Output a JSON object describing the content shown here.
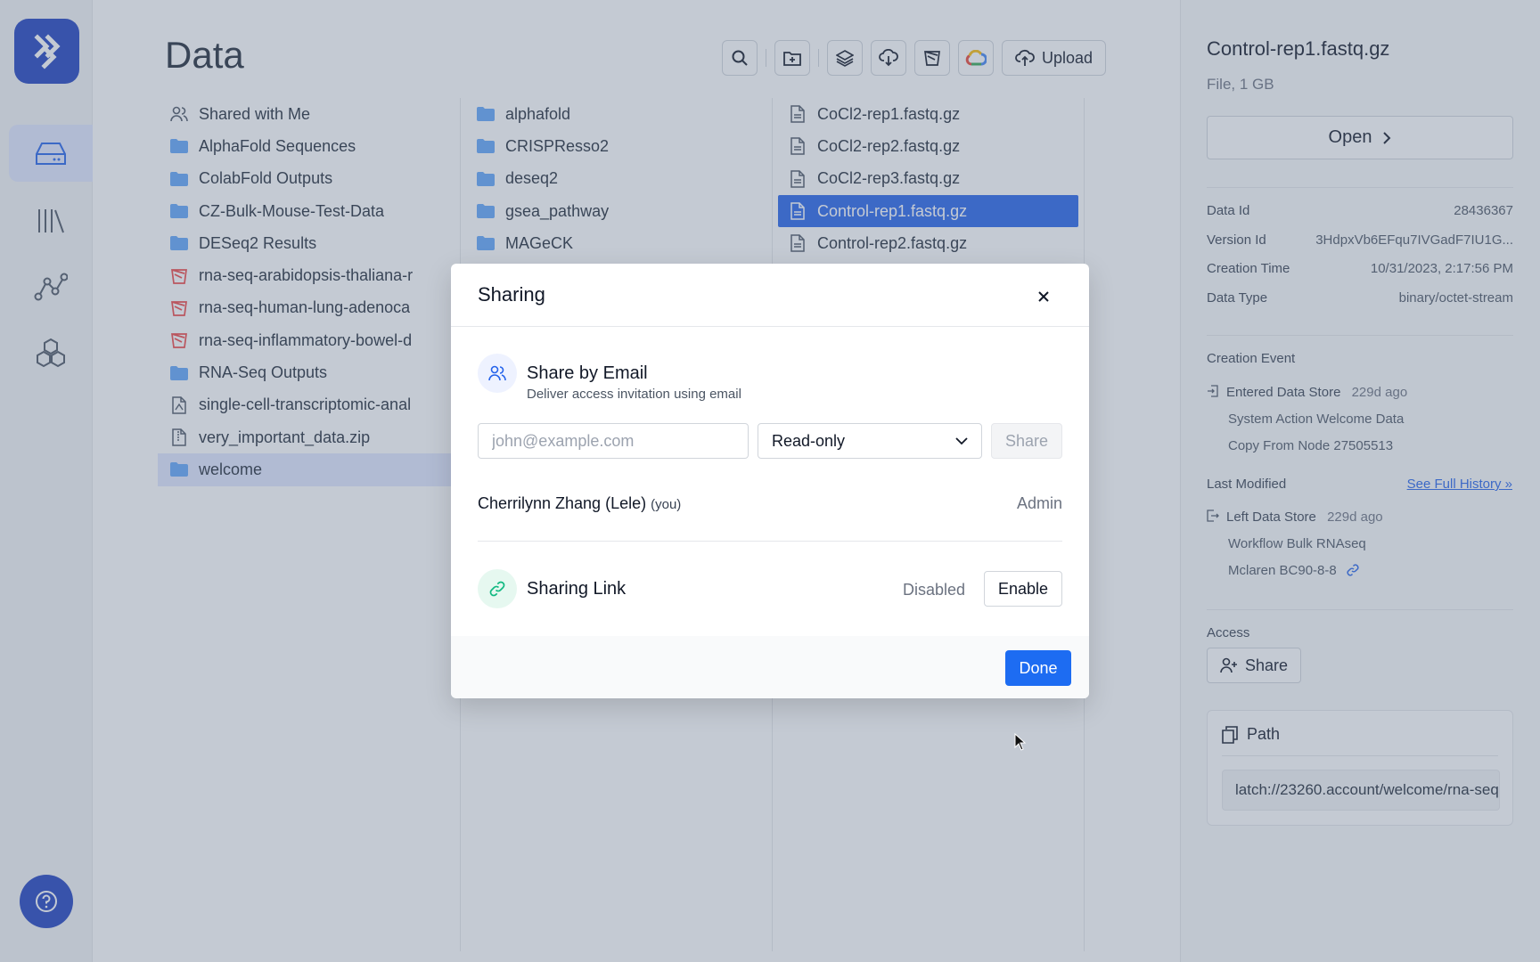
{
  "main": {
    "title": "Data",
    "toolbar": {
      "upload_label": "Upload",
      "icons": [
        "search-icon",
        "new-folder-icon",
        "layers-icon",
        "cloud-download-icon",
        "bucket-icon",
        "google-cloud-icon",
        "upload-cloud-icon"
      ]
    },
    "column1": [
      {
        "label": "Shared with Me",
        "icon": "users-icon"
      },
      {
        "label": "AlphaFold Sequences",
        "icon": "folder-icon"
      },
      {
        "label": "ColabFold Outputs",
        "icon": "folder-icon"
      },
      {
        "label": "CZ-Bulk-Mouse-Test-Data",
        "icon": "folder-icon"
      },
      {
        "label": "DESeq2 Results",
        "icon": "folder-icon"
      },
      {
        "label": "rna-seq-arabidopsis-thaliana-r",
        "icon": "bucket-icon"
      },
      {
        "label": "rna-seq-human-lung-adenoca",
        "icon": "bucket-icon"
      },
      {
        "label": "rna-seq-inflammatory-bowel-d",
        "icon": "bucket-icon"
      },
      {
        "label": "RNA-Seq Outputs",
        "icon": "folder-icon"
      },
      {
        "label": "single-cell-transcriptomic-anal",
        "icon": "file-icon"
      },
      {
        "label": "very_important_data.zip",
        "icon": "zip-file-icon"
      },
      {
        "label": "welcome",
        "icon": "folder-icon",
        "selected": true
      }
    ],
    "column2": [
      {
        "label": "alphafold",
        "icon": "folder-icon"
      },
      {
        "label": "CRISPResso2",
        "icon": "folder-icon"
      },
      {
        "label": "deseq2",
        "icon": "folder-icon"
      },
      {
        "label": "gsea_pathway",
        "icon": "folder-icon"
      },
      {
        "label": "MAGeCK",
        "icon": "folder-icon"
      }
    ],
    "column3": [
      {
        "label": "CoCl2-rep1.fastq.gz",
        "icon": "text-file-icon"
      },
      {
        "label": "CoCl2-rep2.fastq.gz",
        "icon": "text-file-icon"
      },
      {
        "label": "CoCl2-rep3.fastq.gz",
        "icon": "text-file-icon"
      },
      {
        "label": "Control-rep1.fastq.gz",
        "icon": "text-file-icon",
        "selected": true
      },
      {
        "label": "Control-rep2.fastq.gz",
        "icon": "text-file-icon"
      }
    ]
  },
  "detail": {
    "title": "Control-rep1.fastq.gz",
    "subtitle": "File, 1 GB",
    "open_label": "Open",
    "fields": [
      {
        "key": "Data Id",
        "value": "28436367"
      },
      {
        "key": "Version Id",
        "value": "3HdpxVb6EFqu7IVGadF7IU1G..."
      },
      {
        "key": "Creation Time",
        "value": "10/31/2023, 2:17:56 PM"
      },
      {
        "key": "Data Type",
        "value": "binary/octet-stream"
      }
    ],
    "creation_event_label": "Creation Event",
    "creation_event": {
      "title": "Entered Data Store",
      "ago": "229d ago",
      "line1": "System Action Welcome Data",
      "line2": "Copy From Node 27505513"
    },
    "last_modified_label": "Last Modified",
    "full_history_label": "See Full History »",
    "last_modified": {
      "title": "Left Data Store",
      "ago": "229d ago",
      "line1": "Workflow Bulk RNAseq",
      "line2": "Mclaren BC90-8-8"
    },
    "access_label": "Access",
    "share_label": "Share",
    "path_label": "Path",
    "path_value": "latch://23260.account/welcome/rna-seq"
  },
  "modal": {
    "title": "Sharing",
    "email_heading": "Share by Email",
    "email_sub": "Deliver access invitation using email",
    "email_placeholder": "john@example.com",
    "permission_value": "Read-only",
    "share_label": "Share",
    "user_name": "Cherrilynn Zhang (Lele)",
    "user_you": "(you)",
    "user_role": "Admin",
    "link_heading": "Sharing Link",
    "link_status": "Disabled",
    "enable_label": "Enable",
    "done_label": "Done"
  },
  "colors": {
    "brand": "#1e3fbf",
    "primary": "#1d6cf2",
    "selection": "#2563eb",
    "folder": "#60a5fa",
    "bucket": "#ef4444",
    "link": "#2563eb"
  }
}
